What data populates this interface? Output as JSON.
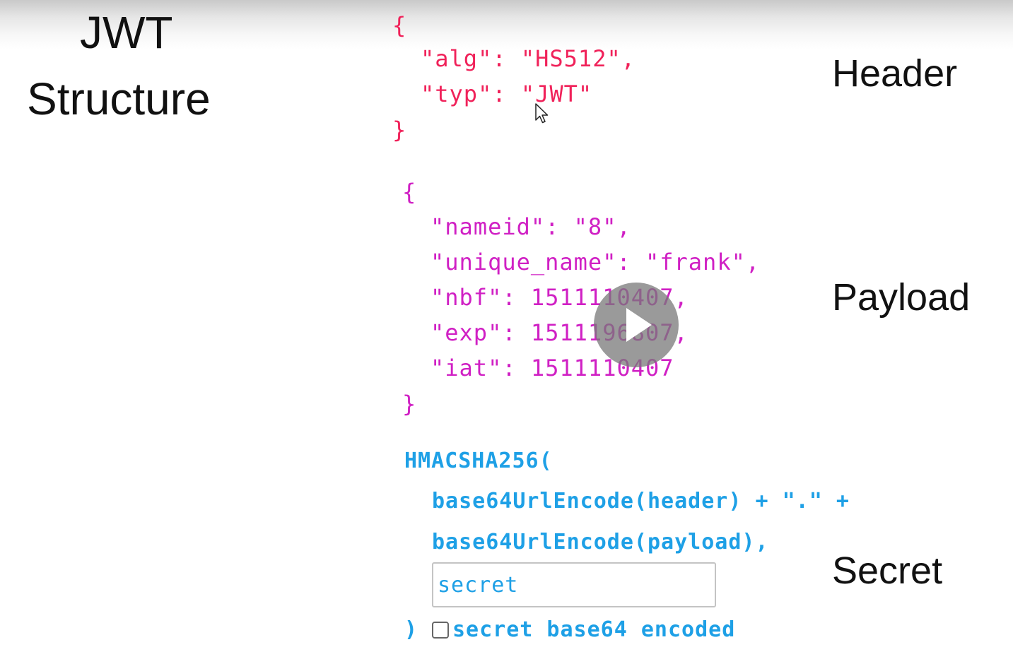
{
  "title": {
    "line1": "JWT",
    "line2": "Structure"
  },
  "sections": {
    "header_label": "Header",
    "payload_label": "Payload",
    "secret_label": "Secret"
  },
  "header_json": [
    "{",
    "\"alg\": \"HS512\",",
    "\"typ\": \"JWT\"",
    "}"
  ],
  "payload_json": [
    "{",
    "\"nameid\": \"8\",",
    "\"unique_name\": \"frank\",",
    "\"nbf\": 1511110407,",
    "\"exp\": 1511196807,",
    "\"iat\": 1511110407",
    "}"
  ],
  "signature": {
    "open": "HMACSHA256(",
    "line1": "base64UrlEncode(header) + \".\" +",
    "line2": "base64UrlEncode(payload),",
    "secret_value": "secret",
    "close": ")",
    "checkbox_label": "secret base64 encoded",
    "checkbox_checked": false
  },
  "colors": {
    "header": "#f0225a",
    "payload": "#d020c4",
    "signature": "#1ea0e6"
  },
  "icons": {
    "video_overlay": "play-icon",
    "pointer": "mouse-cursor-icon"
  }
}
